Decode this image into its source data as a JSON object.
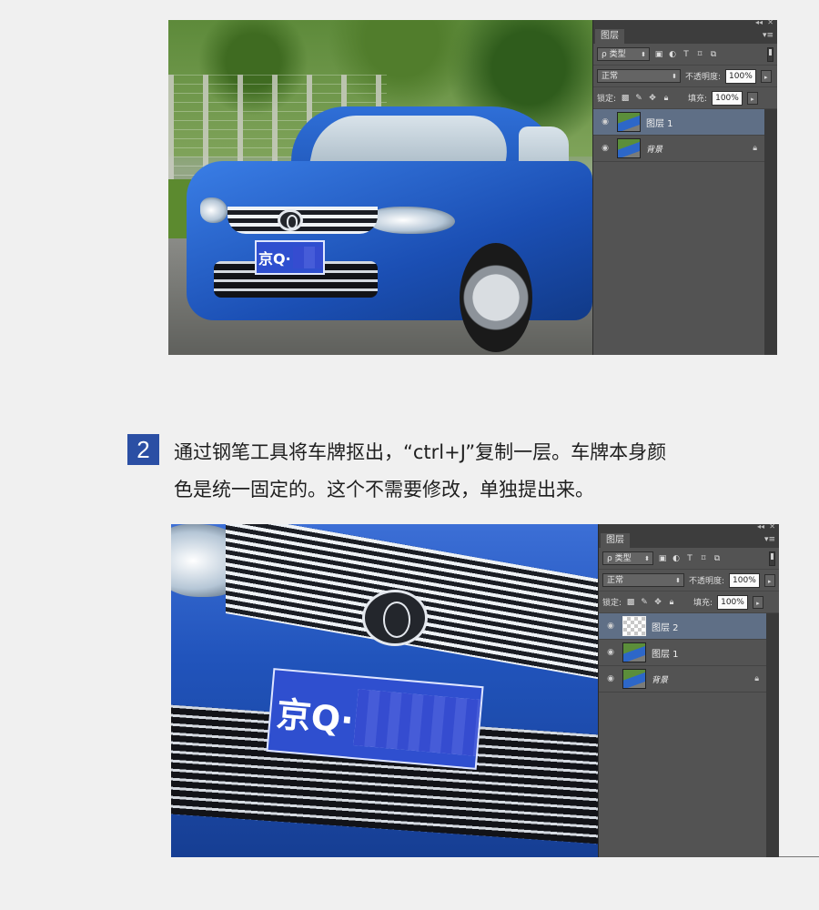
{
  "screenshot1": {
    "panel": {
      "tab": "图层",
      "filter_label": "ρ 类型",
      "blend_mode": "正常",
      "opacity_label": "不透明度:",
      "opacity_value": "100%",
      "lock_label": "锁定:",
      "fill_label": "填充:",
      "fill_value": "100%",
      "layers": [
        {
          "name": "图层 1",
          "selected": true,
          "thumbnail": "car-photo"
        },
        {
          "name": "背景",
          "selected": false,
          "thumbnail": "car-photo",
          "locked": true
        }
      ]
    },
    "plate_text": "京Q·"
  },
  "step": {
    "number": "2",
    "line1": "通过钢笔工具将车牌抠出，“ctrl+J”复制一层。车牌本身颜",
    "line2": "色是统一固定的。这个不需要修改，单独提出来。"
  },
  "screenshot2": {
    "panel": {
      "tab": "图层",
      "filter_label": "ρ 类型",
      "blend_mode": "正常",
      "opacity_label": "不透明度:",
      "opacity_value": "100%",
      "lock_label": "锁定:",
      "fill_label": "填充:",
      "fill_value": "100%",
      "layers": [
        {
          "name": "图层 2",
          "selected": true,
          "thumbnail": "transparent"
        },
        {
          "name": "图层 1",
          "selected": false,
          "thumbnail": "car-photo"
        },
        {
          "name": "背景",
          "selected": false,
          "thumbnail": "car-photo",
          "locked": true
        }
      ]
    },
    "plate_text": "京Q·"
  },
  "icons": {
    "eye": "eye-icon",
    "lock": "lock-icon",
    "collapse": "double-chevron-icon",
    "close": "close-icon",
    "menu": "panel-menu-icon"
  },
  "colors": {
    "step_badge": "#2b4fa4",
    "panel_bg": "#535353",
    "selected_layer": "#5f6f86"
  }
}
